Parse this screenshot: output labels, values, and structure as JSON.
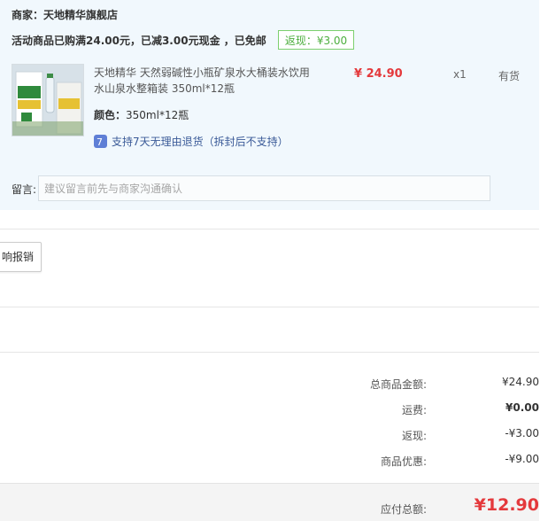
{
  "order": {
    "merchant": "商家：天地精华旗舰店",
    "promo": "活动商品已购满24.00元，已减3.00元现金 ，已免邮",
    "cashback": "返现：¥3.00",
    "product": {
      "name": "天地精华 天然弱碱性小瓶矿泉水大桶装水饮用水山泉水整箱装 350ml*12瓶",
      "price": "¥ 24.90",
      "qty": "x1",
      "stock": "有货",
      "spec_key": "颜色：",
      "spec_value": "350ml*12瓶",
      "return_policy": "支持7天无理由退货（拆封后不支持）",
      "thumb_icon": "product-image"
    },
    "message": {
      "label": "留言:",
      "placeholder": "建议留言前先与商家沟通确认"
    }
  },
  "invoice": {
    "button_label": "响报销"
  },
  "summary": {
    "rows": [
      {
        "label": "总商品金额:",
        "value": "¥24.90"
      },
      {
        "label": "运费:",
        "value": "¥0.00"
      },
      {
        "label": "返现:",
        "value": "-¥3.00"
      },
      {
        "label": "商品优惠:",
        "value": "-¥9.00"
      }
    ],
    "total_label": "应付总额:",
    "total_value": "¥12.90"
  },
  "colors": {
    "accent_red": "#e4393c",
    "panel_bg": "#f1f8fd",
    "cashback_green": "#4cae3d",
    "link_blue": "#3a5a98"
  }
}
